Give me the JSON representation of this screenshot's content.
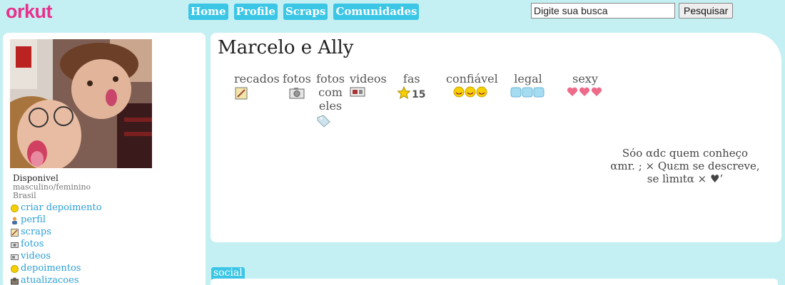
{
  "header": {
    "logo": "orkut",
    "nav": [
      "Home",
      "Profile",
      "Scraps",
      "Comunidades"
    ],
    "search_placeholder": "Digite sua busca",
    "search_button": "Pesquisar"
  },
  "sidebar": {
    "status": "Disponivel",
    "gender": "masculino/feminino",
    "country": "Brasil",
    "menu": [
      {
        "label": "criar depoimento",
        "icon": "smiley-icon"
      },
      {
        "label": "perfil",
        "icon": "user-icon"
      },
      {
        "label": "scraps",
        "icon": "notepad-icon"
      },
      {
        "label": "fotos",
        "icon": "camera-icon"
      },
      {
        "label": "videos",
        "icon": "video-icon"
      },
      {
        "label": "depoimentos",
        "icon": "smiley-icon"
      },
      {
        "label": "atualizacoes",
        "icon": "update-icon"
      }
    ]
  },
  "profile": {
    "name": "Marcelo e Ally",
    "stats": {
      "recados": "recados",
      "fotos": "fotos",
      "fotos_com_eles": "fotos com eles",
      "videos": "videos",
      "fas": "fas",
      "fas_count": "15",
      "confiavel": "confiável",
      "legal": "legal",
      "sexy": "sexy"
    },
    "bio": "Sóo αdc quem conheço αmr. ; × Quεm se descreve, se lìmıtα × ♥’"
  },
  "social_tab": "social",
  "colors": {
    "background": "#c4eff3",
    "accent": "#3cc6e6",
    "logo": "#e8308c",
    "link": "#2c9fd8"
  }
}
